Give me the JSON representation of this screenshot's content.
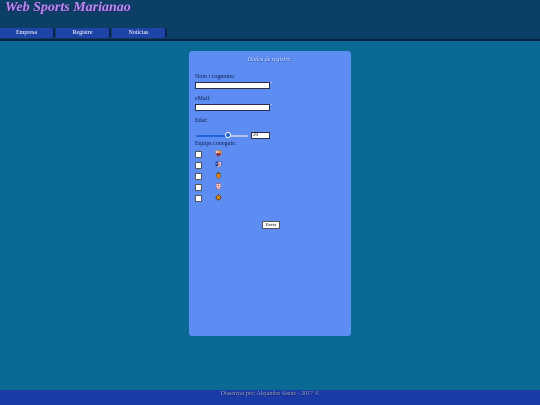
{
  "header": {
    "title": "Web Sports Marianao"
  },
  "nav": {
    "items": [
      "Empresa",
      "Registre",
      "Notícias"
    ]
  },
  "form": {
    "title": "Dades de registre:",
    "name_label": "Nom i cognoms:",
    "name_value": "",
    "name_required": "*",
    "email_label": "eMail:",
    "email_value": "",
    "email_required": "*",
    "age_label": "Edat:",
    "age_value": "20",
    "age_slider_fraction": 0.62,
    "teams_label": "Equips coneguts:",
    "teams": [
      {
        "icon": "fc-barcelona-crest-icon",
        "checked": false
      },
      {
        "icon": "atletico-madrid-crest-icon",
        "checked": false
      },
      {
        "icon": "valencia-crest-icon",
        "checked": false
      },
      {
        "icon": "sevilla-crest-icon",
        "checked": false
      },
      {
        "icon": "fourth-team-crest-icon",
        "checked": false
      }
    ],
    "submit_label": "Envia"
  },
  "footer": {
    "text": "Dissenyat per: Alejandro Sáenz - 2017 ©"
  },
  "colors": {
    "background": "#0a6a94",
    "header": "#0b3f66",
    "nav_button": "#1f44a8",
    "form_panel": "#5d8df2",
    "footer": "#1a3aa8",
    "title_text": "#b48ef0"
  }
}
